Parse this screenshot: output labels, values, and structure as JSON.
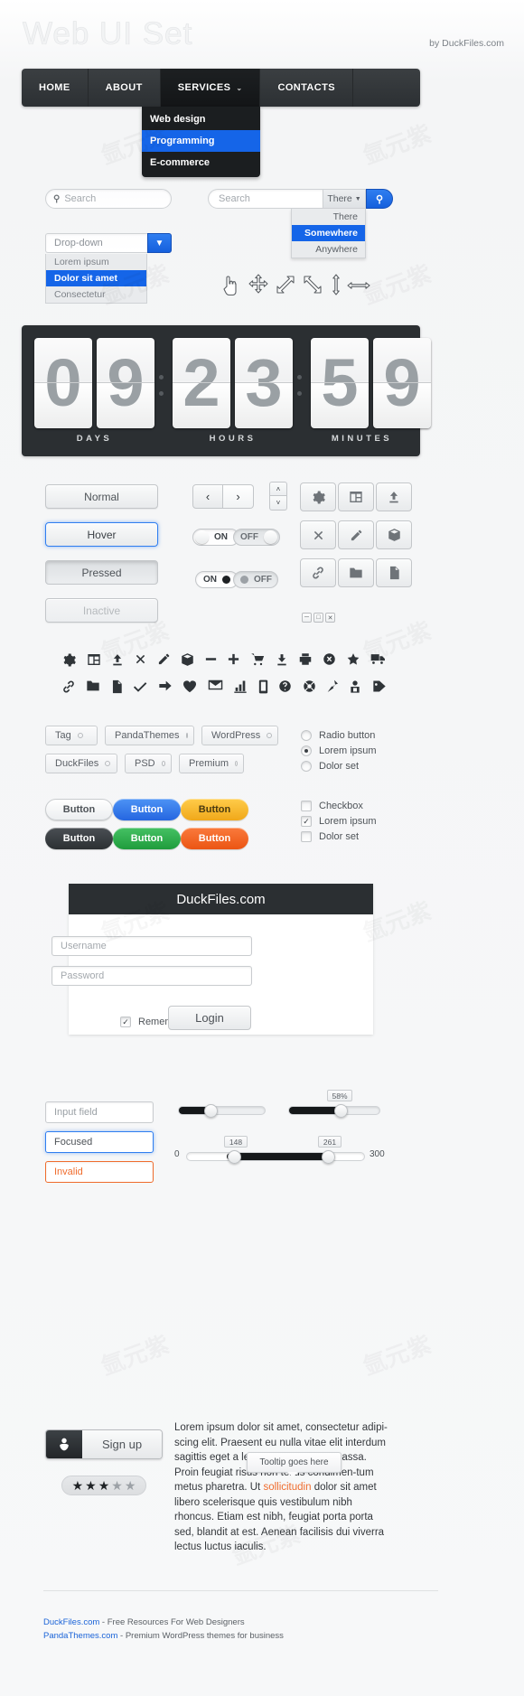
{
  "header": {
    "logo": "Web UI Set",
    "byline": "by DuckFiles.com"
  },
  "nav": {
    "items": [
      {
        "label": "HOME",
        "active": false
      },
      {
        "label": "ABOUT",
        "active": false
      },
      {
        "label": "SERVICES",
        "active": true,
        "caret": "⌄"
      },
      {
        "label": "CONTACTS",
        "active": false
      }
    ],
    "submenu": [
      {
        "label": "Web design",
        "selected": false
      },
      {
        "label": "Programming",
        "selected": true
      },
      {
        "label": "E-commerce",
        "selected": false
      }
    ]
  },
  "search": {
    "pill_placeholder": "Search",
    "magnifier": "search-icon",
    "box_placeholder": "Search",
    "scope_value": "There",
    "scope_options": [
      "There",
      "Somewhere",
      "Anywhere"
    ],
    "scope_selected": "Somewhere",
    "go_label": "search-icon"
  },
  "dropdown": {
    "value": "Drop-down",
    "options": [
      "Lorem ipsum",
      "Dolor sit amet",
      "Consectetur"
    ],
    "selected": "Dolor sit amet"
  },
  "cursors": [
    "pointer-hand-icon",
    "move-icon",
    "resize-nesw-icon",
    "resize-nwse-icon",
    "resize-vertical-icon",
    "resize-horizontal-icon"
  ],
  "counter": {
    "groups": [
      {
        "digits": [
          "0",
          "9"
        ],
        "label": "DAYS"
      },
      {
        "digits": [
          "2",
          "3"
        ],
        "label": "HOURS"
      },
      {
        "digits": [
          "5",
          "9"
        ],
        "label": "MINUTES"
      }
    ]
  },
  "buttons": {
    "states": [
      "Normal",
      "Hover",
      "Pressed",
      "Inactive"
    ],
    "pager": {
      "prev": "‹",
      "next": "›"
    },
    "spinner": {
      "up": "˄",
      "down": "˅"
    }
  },
  "toggles": [
    {
      "label": "ON",
      "state": "on",
      "style": "text"
    },
    {
      "label": "OFF",
      "state": "off",
      "style": "text"
    },
    {
      "label": "ON",
      "state": "on",
      "style": "dot"
    },
    {
      "label": "OFF",
      "state": "off",
      "style": "dot"
    }
  ],
  "icon_buttons": [
    [
      "gear-icon",
      "window-icon",
      "upload-icon"
    ],
    [
      "close-x-icon",
      "pencil-icon",
      "box-icon"
    ],
    [
      "link-icon",
      "folder-icon",
      "file-icon"
    ]
  ],
  "window_controls": [
    "minimize-icon",
    "maximize-icon",
    "close-icon"
  ],
  "icon_grid": {
    "row1": [
      "gear-icon",
      "window-icon",
      "upload-icon",
      "close-x-icon",
      "pencil-icon",
      "box-icon",
      "minus-icon",
      "plus-icon",
      "cart-icon",
      "download-icon",
      "printer-icon",
      "cancel-circle-icon",
      "star-icon",
      "truck-icon"
    ],
    "row2": [
      "link-icon",
      "folder-icon",
      "file-icon",
      "check-icon",
      "arrow-right-icon",
      "heart-icon",
      "mail-icon",
      "bar-chart-icon",
      "mobile-icon",
      "help-icon",
      "lifebuoy-icon",
      "pin-icon",
      "user-badge-icon",
      "tag-icon"
    ]
  },
  "tags": [
    [
      "Tag",
      "PandaThemes",
      "WordPress"
    ],
    [
      "DuckFiles",
      "PSD",
      "Premium"
    ]
  ],
  "radios": [
    {
      "label": "Radio button",
      "checked": false
    },
    {
      "label": "Lorem ipsum",
      "checked": true
    },
    {
      "label": "Dolor set",
      "checked": false
    }
  ],
  "checkboxes": [
    {
      "label": "Checkbox",
      "checked": false
    },
    {
      "label": "Lorem ipsum",
      "checked": true
    },
    {
      "label": "Dolor set",
      "checked": false
    }
  ],
  "colored_buttons": [
    {
      "label": "Button",
      "color": "#f4f5f6",
      "text": "#4e5358"
    },
    {
      "label": "Button",
      "color": "#3b82ef",
      "text": "#ffffff"
    },
    {
      "label": "Button",
      "color": "#f5bb28",
      "text": "#3b3116"
    },
    {
      "label": "Button",
      "color": "#3a3f43",
      "text": "#ffffff"
    },
    {
      "label": "Button",
      "color": "#2fae4a",
      "text": "#ffffff"
    },
    {
      "label": "Button",
      "color": "#f26122",
      "text": "#ffffff"
    }
  ],
  "login": {
    "title": "DuckFiles.com",
    "username_placeholder": "Username",
    "password_placeholder": "Password",
    "remember_label": "Remember me",
    "remember_checked": true,
    "submit_label": "Login"
  },
  "input_states": [
    {
      "label": "Input field",
      "state": "normal"
    },
    {
      "label": "Focused",
      "state": "focused"
    },
    {
      "label": "Invalid",
      "state": "invalid"
    }
  ],
  "sliders": {
    "single_left": {
      "value_pct": 32
    },
    "single_right": {
      "value_pct": 58,
      "bubble": "58%"
    },
    "range": {
      "min_label": "0",
      "max_label": "300",
      "low": "148",
      "high": "261",
      "low_pct": 22,
      "high_pct": 78
    }
  },
  "signup": {
    "label": "Sign up",
    "icon": "user-icon"
  },
  "rating": {
    "filled": 3,
    "total": 5
  },
  "paragraph": {
    "text_before": "Lorem ipsum dolor sit amet, consectetur adipi-scing elit. Praesent eu nulla vitae elit interdum sagittis eget a leo. Nullam vel erat massa. Proin feugiat risus non tellus condimen-tum metus pharetra. Ut ",
    "highlight": "sollicitudin",
    "text_after": " dolor sit amet libero scelerisque quis vestibulum nibh rhoncus. Etiam est nibh, feugiat porta porta sed, blandit at est. Aenean facilisis dui viverra lectus luctus iaculis.",
    "tooltip": "Tooltip goes here"
  },
  "footer": [
    {
      "link": "DuckFiles.com",
      "rest": " - Free Resources For Web Designers"
    },
    {
      "link": "PandaThemes.com",
      "rest": " - Premium WordPress themes for business"
    }
  ]
}
